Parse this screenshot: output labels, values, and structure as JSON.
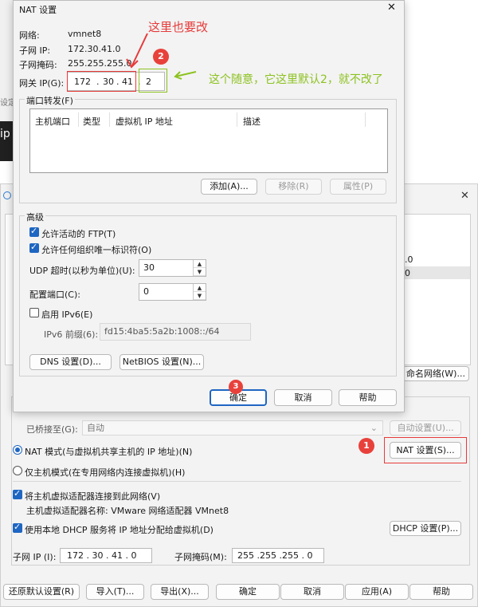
{
  "nat": {
    "title": "NAT 设置",
    "network_label": "网络:",
    "network_value": "vmnet8",
    "subnet_ip_label": "子网 IP:",
    "subnet_ip_value": "172.30.41.0",
    "subnet_mask_label": "子网掩码:",
    "subnet_mask_value": "255.255.255.0",
    "gateway_label": "网关 IP(G):",
    "gateway_octets": [
      "172",
      "30",
      "41",
      "2"
    ],
    "port_forward_label": "端口转发(F)",
    "port_columns": [
      "主机端口",
      "类型",
      "虚拟机 IP 地址",
      "描述"
    ],
    "add_button": "添加(A)...",
    "remove_button": "移除(R)",
    "properties_button": "属性(P)",
    "advanced_label": "高级",
    "allow_ftp": "允许活动的 FTP(T)",
    "allow_oui": "允许任何组织唯一标识符(O)",
    "udp_label": "UDP 超时(以秒为单位)(U):",
    "udp_value": "30",
    "config_port_label": "配置端口(C):",
    "config_port_value": "0",
    "ipv6_enable": "启用 IPv6(E)",
    "ipv6_prefix_label": "IPv6 前缀(6):",
    "ipv6_prefix_value": "fd15:4ba5:5a2b:1008::/64",
    "dns_button": "DNS 设置(D)...",
    "netbios_button": "NetBIOS 设置(N)...",
    "ok_button": "确定",
    "cancel_button": "取消",
    "help_button": "帮助"
  },
  "annotations": {
    "change_here": "这里也要改",
    "default_note": "这个随意，它这里默认2，就不改了",
    "badge1": "1",
    "badge2": "2",
    "badge3": "3"
  },
  "editor": {
    "close_glyph": "✕",
    "behind_text_1": ".0",
    "behind_text_2": "0",
    "rename_button": "命名网络(W)...",
    "bridged_label": "已桥接至(G):",
    "bridged_value": "自动",
    "auto_settings_button": "自动设置(U)...",
    "nat_mode": "NAT 模式(与虚拟机共享主机的 IP 地址)(N)",
    "nat_settings_button": "NAT 设置(S)...",
    "host_only_mode": "仅主机模式(在专用网络内连接虚拟机)(H)",
    "connect_adapter": "将主机虚拟适配器连接到此网络(V)",
    "adapter_name": "主机虚拟适配器名称: VMware 网络适配器 VMnet8",
    "use_dhcp": "使用本地 DHCP 服务将 IP 地址分配给虚拟机(D)",
    "dhcp_button": "DHCP 设置(P)...",
    "subnet_ip_label": "子网 IP (I):",
    "subnet_ip_value": "172 . 30 . 41 . 0",
    "subnet_mask_label": "子网掩码(M):",
    "subnet_mask_value": "255 .255 .255 . 0",
    "restore_button": "还原默认设置(R)",
    "import_button": "导入(T)...",
    "export_button": "导出(X)...",
    "ok_button": "确定",
    "cancel_button": "取消",
    "apply_button": "应用(A)",
    "help_button": "帮助"
  },
  "background_fragments": {
    "ip": "ip",
    "cfg": "设定"
  }
}
